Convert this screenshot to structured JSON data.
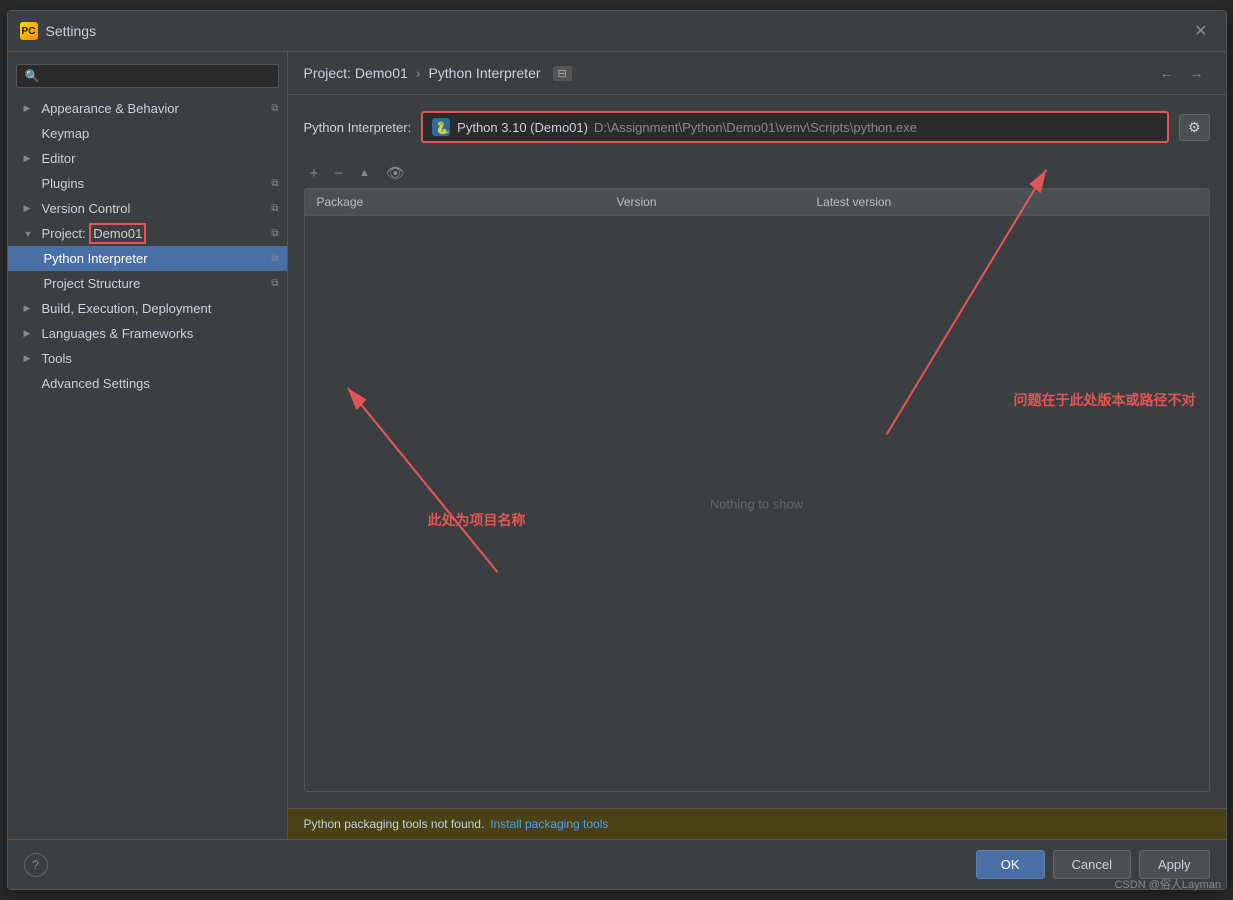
{
  "dialog": {
    "title": "Settings",
    "app_icon": "PC"
  },
  "search": {
    "placeholder": "🔍"
  },
  "sidebar": {
    "items": [
      {
        "id": "appearance",
        "label": "Appearance & Behavior",
        "expanded": true,
        "indent": 0
      },
      {
        "id": "keymap",
        "label": "Keymap",
        "indent": 0
      },
      {
        "id": "editor",
        "label": "Editor",
        "expanded": false,
        "indent": 0
      },
      {
        "id": "plugins",
        "label": "Plugins",
        "indent": 0
      },
      {
        "id": "version-control",
        "label": "Version Control",
        "indent": 0
      },
      {
        "id": "project",
        "label": "Project: Demo01",
        "expanded": true,
        "indent": 0,
        "highlighted": true
      },
      {
        "id": "python-interpreter",
        "label": "Python Interpreter",
        "indent": 1,
        "active": true
      },
      {
        "id": "project-structure",
        "label": "Project Structure",
        "indent": 1
      },
      {
        "id": "build",
        "label": "Build, Execution, Deployment",
        "indent": 0
      },
      {
        "id": "languages",
        "label": "Languages & Frameworks",
        "indent": 0
      },
      {
        "id": "tools",
        "label": "Tools",
        "indent": 0
      },
      {
        "id": "advanced",
        "label": "Advanced Settings",
        "indent": 0
      }
    ]
  },
  "header": {
    "breadcrumb_root": "Project: Demo01",
    "breadcrumb_separator": "›",
    "breadcrumb_current": "Python Interpreter"
  },
  "interpreter": {
    "label": "Python Interpreter:",
    "name": "Python 3.10 (Demo01)",
    "path": "D:\\Assignment\\Python\\Demo01\\venv\\Scripts\\python.exe",
    "icon": "🐍"
  },
  "toolbar": {
    "add": "+",
    "remove": "−",
    "up": "▲",
    "show": "👁"
  },
  "table": {
    "columns": [
      "Package",
      "Version",
      "Latest version"
    ],
    "empty_text": "Nothing to show"
  },
  "status_bar": {
    "message": "Python packaging tools not found.",
    "link_text": "Install packaging tools"
  },
  "footer": {
    "ok": "OK",
    "cancel": "Cancel",
    "apply": "Apply"
  },
  "annotations": {
    "project_name_note": "此处为项目名称",
    "version_path_note": "问题在于此处版本或路径不对"
  },
  "watermark": "CSDN @俗人Layman"
}
